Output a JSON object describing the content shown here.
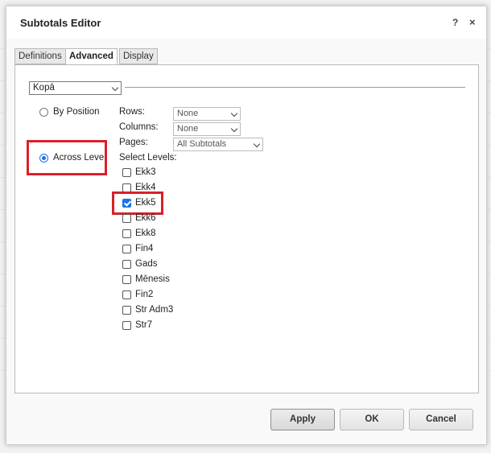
{
  "dialog": {
    "title": "Subtotals Editor",
    "help_glyph": "?",
    "close_glyph": "×"
  },
  "tabs": [
    {
      "label": "Definitions",
      "active": false
    },
    {
      "label": "Advanced",
      "active": true
    },
    {
      "label": "Display",
      "active": false
    }
  ],
  "subtotal_select": {
    "value": "Kopā"
  },
  "mode": {
    "by_position_label": "By Position",
    "across_level_label": "Across Level",
    "selected": "across_level"
  },
  "position_fields": {
    "rows": {
      "label": "Rows:",
      "value": "None"
    },
    "columns": {
      "label": "Columns:",
      "value": "None"
    },
    "pages": {
      "label": "Pages:",
      "value": "All Subtotals"
    }
  },
  "levels": {
    "label": "Select Levels:",
    "items": [
      {
        "label": "Ekk3",
        "checked": false
      },
      {
        "label": "Ekk4",
        "checked": false
      },
      {
        "label": "Ekk5",
        "checked": true
      },
      {
        "label": "Ekk6",
        "checked": false
      },
      {
        "label": "Ekk8",
        "checked": false
      },
      {
        "label": "Fin4",
        "checked": false
      },
      {
        "label": "Gads",
        "checked": false
      },
      {
        "label": "Mēnesis",
        "checked": false
      },
      {
        "label": "Fin2",
        "checked": false
      },
      {
        "label": "Str Adm3",
        "checked": false
      },
      {
        "label": "Str7",
        "checked": false
      }
    ]
  },
  "footer": {
    "apply_label": "Apply",
    "ok_label": "OK",
    "cancel_label": "Cancel"
  },
  "colors": {
    "accent": "#1a73e8",
    "highlight": "#d9202a"
  }
}
